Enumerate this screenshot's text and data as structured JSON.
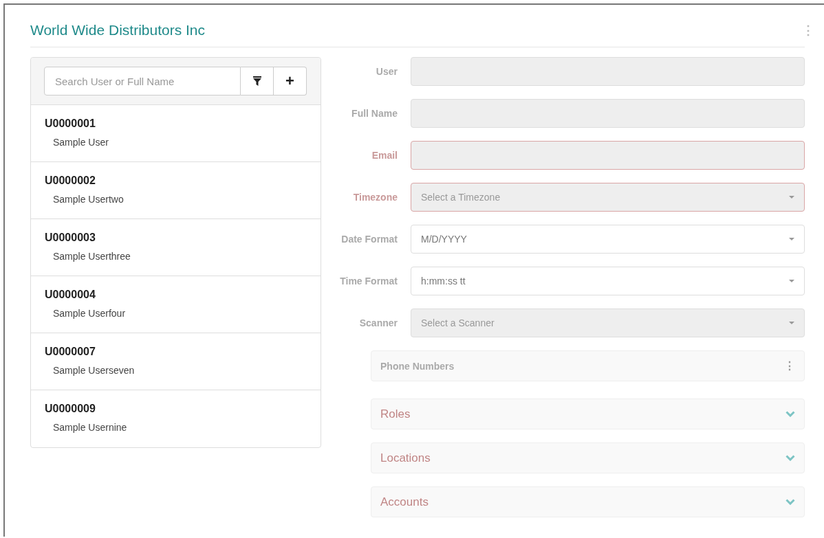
{
  "header": {
    "title": "World Wide Distributors Inc",
    "menu_icon": "⋮"
  },
  "user_list": {
    "search": {
      "placeholder": "Search User or Full Name"
    },
    "add_button": "+",
    "users": [
      {
        "id": "U0000001",
        "name": "Sample User"
      },
      {
        "id": "U0000002",
        "name": "Sample Usertwo"
      },
      {
        "id": "U0000003",
        "name": "Sample Userthree"
      },
      {
        "id": "U0000004",
        "name": "Sample Userfour"
      },
      {
        "id": "U0000007",
        "name": "Sample Userseven"
      },
      {
        "id": "U0000009",
        "name": "Sample Usernine"
      }
    ]
  },
  "form": {
    "fields": [
      {
        "label": "User",
        "kind": "text",
        "error": false,
        "disabled": true
      },
      {
        "label": "Full Name",
        "kind": "text",
        "error": false,
        "disabled": true
      },
      {
        "label": "Email",
        "kind": "text",
        "error": true,
        "disabled": true
      },
      {
        "label": "Timezone",
        "kind": "select",
        "error": true,
        "disabled": true,
        "placeholder": "Select a Timezone"
      },
      {
        "label": "Date Format",
        "kind": "select",
        "error": false,
        "disabled": false,
        "value": "M/D/YYYY"
      },
      {
        "label": "Time Format",
        "kind": "select",
        "error": false,
        "disabled": false,
        "value": "h:mm:ss tt"
      },
      {
        "label": "Scanner",
        "kind": "select",
        "error": false,
        "disabled": true,
        "placeholder": "Select a Scanner"
      }
    ],
    "panels": [
      {
        "title": "Phone Numbers",
        "kind": "menu",
        "error": false,
        "icon": "⋮"
      },
      {
        "title": "Roles",
        "kind": "collapse",
        "error": true
      },
      {
        "title": "Locations",
        "kind": "collapse",
        "error": true
      },
      {
        "title": "Accounts",
        "kind": "collapse",
        "error": true
      }
    ]
  }
}
